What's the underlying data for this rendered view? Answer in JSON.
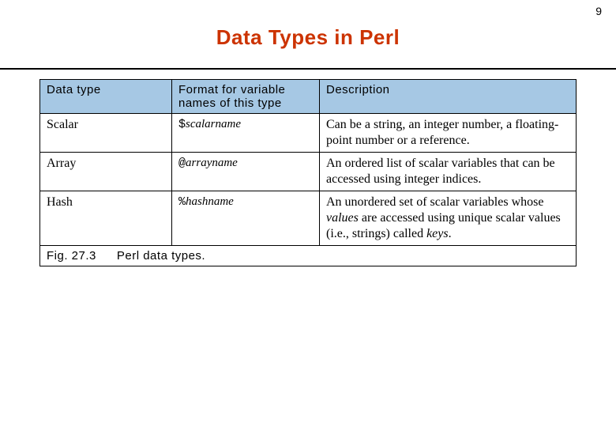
{
  "page_number": "9",
  "title": "Data Types in Perl",
  "colors": {
    "title": "#cc3300",
    "header_bg": "#a6c8e4"
  },
  "table": {
    "headers": {
      "type": "Data type",
      "format": "Format for variable names of this type",
      "description": "Description"
    },
    "rows": [
      {
        "type": "Scalar",
        "sigil": "$",
        "varname": "scalarname",
        "desc_pre": "Can be a string, an integer number, a floating-point number or a reference.",
        "desc_ital1": "",
        "desc_mid": "",
        "desc_ital2": "",
        "desc_post": ""
      },
      {
        "type": "Array",
        "sigil": "@",
        "varname": "arrayname",
        "desc_pre": "An ordered list of scalar variables that can be accessed using integer indices.",
        "desc_ital1": "",
        "desc_mid": "",
        "desc_ital2": "",
        "desc_post": ""
      },
      {
        "type": "Hash",
        "sigil": "%",
        "varname": "hashname",
        "desc_pre": "An unordered set of scalar variables whose ",
        "desc_ital1": "values",
        "desc_mid": " are accessed using unique scalar values (i.e., strings) called ",
        "desc_ital2": "keys",
        "desc_post": "."
      }
    ],
    "caption": {
      "fig_label": "Fig. 27.3",
      "text": "Perl data types."
    }
  }
}
